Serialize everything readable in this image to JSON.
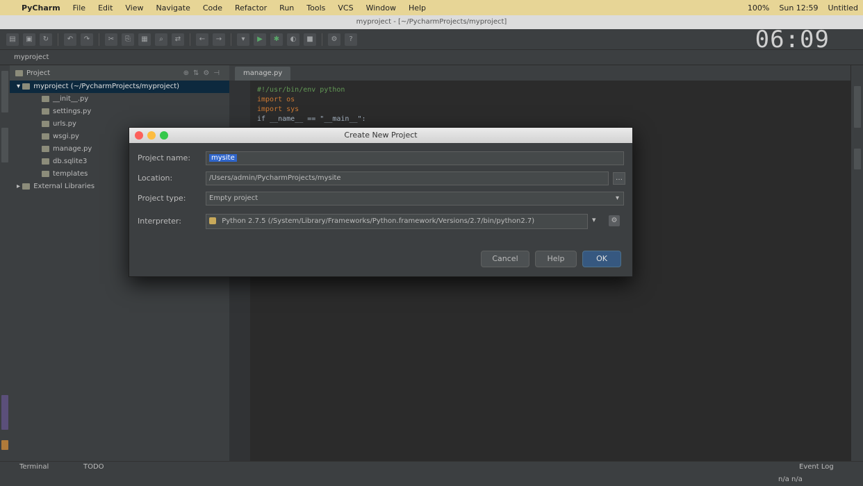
{
  "menubar": {
    "items": [
      "PyCharm",
      "File",
      "Edit",
      "View",
      "Navigate",
      "Code",
      "Refactor",
      "Run",
      "Tools",
      "VCS",
      "Window",
      "Help"
    ],
    "status": [
      "100%",
      "Sun 12:59",
      "Untitled"
    ]
  },
  "window": {
    "title": "myproject - [~/PycharmProjects/myproject]"
  },
  "toolbar": {
    "clock": "06:09"
  },
  "navbar": {
    "path": "myproject"
  },
  "project_panel": {
    "title": "Project",
    "root": "myproject (~/PycharmProjects/myproject)",
    "items": [
      "__init__.py",
      "settings.py",
      "urls.py",
      "wsgi.py",
      "manage.py",
      "db.sqlite3",
      "templates"
    ],
    "external": "External Libraries"
  },
  "editor": {
    "tab": "manage.py",
    "lines": [
      "#!/usr/bin/env python",
      "import os",
      "import sys",
      "if __name__ == \"__main__\":"
    ]
  },
  "dialog": {
    "title": "Create New Project",
    "project_name_label": "Project name:",
    "project_name_value": "mysite",
    "location_label": "Location:",
    "location_value": "/Users/admin/PycharmProjects/mysite",
    "project_type_label": "Project type:",
    "project_type_value": "Empty project",
    "interpreter_label": "Interpreter:",
    "interpreter_value": "Python 2.7.5 (/System/Library/Frameworks/Python.framework/Versions/2.7/bin/python2.7)",
    "cancel": "Cancel",
    "help": "Help",
    "ok": "OK"
  },
  "bottombar": {
    "left_a": "Terminal",
    "left_b": "TODO",
    "right": "Event Log",
    "right_b": "n/a  n/a"
  }
}
